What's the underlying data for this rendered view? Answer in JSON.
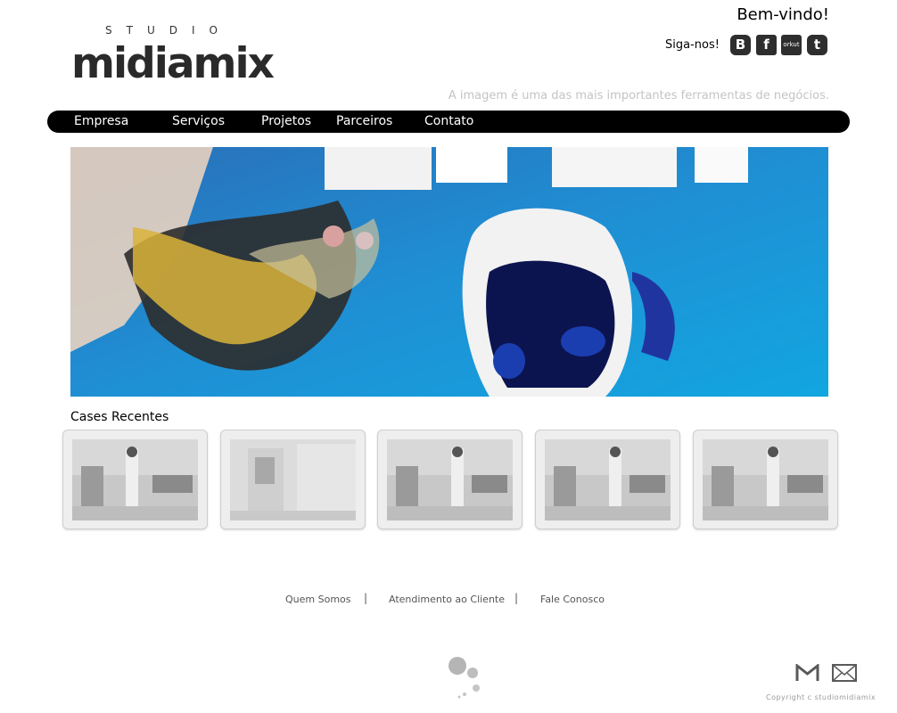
{
  "logo": {
    "studio": "STUDIO",
    "name": "midiamix"
  },
  "header": {
    "welcome": "Bem-vindo!",
    "follow_label": "Siga-nos!",
    "social": [
      {
        "name": "blogger-icon",
        "glyph": "B"
      },
      {
        "name": "facebook-icon",
        "glyph": "f"
      },
      {
        "name": "orkut-icon",
        "glyph": "orkut"
      },
      {
        "name": "twitter-icon",
        "glyph": "t"
      }
    ],
    "tagline": "A imagem  é uma das mais importantes ferramentas de negócios."
  },
  "nav": {
    "items": [
      {
        "label": "Empresa"
      },
      {
        "label": "Serviços"
      },
      {
        "label": "Projetos"
      },
      {
        "label": "Parceiros"
      },
      {
        "label": "Contato"
      }
    ]
  },
  "cases": {
    "title": "Cases Recentes"
  },
  "footer": {
    "links": [
      {
        "label": "Quem Somos"
      },
      {
        "label": "Atendimento ao Cliente"
      },
      {
        "label": "Fale Conosco"
      }
    ],
    "separator": "|",
    "copyright": "Copyright   c  studiomidiamix"
  },
  "colors": {
    "nav_bg": "#000000",
    "tagline": "#c4c4c4",
    "banner_blue": "#1f8fd4"
  }
}
